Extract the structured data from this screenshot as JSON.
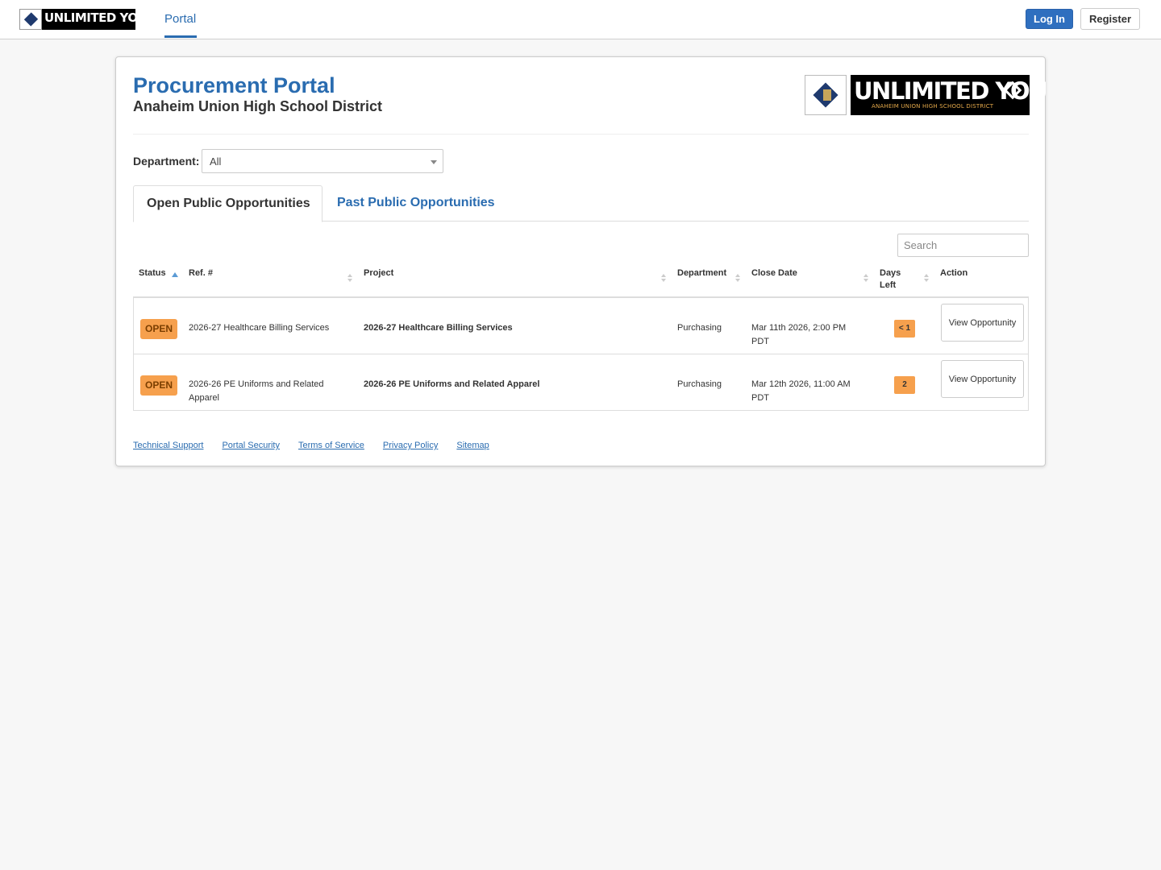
{
  "topnav": {
    "logo_text": "UNLIMITED YOU",
    "tab_portal": "Portal",
    "login": "Log In",
    "register": "Register"
  },
  "header": {
    "title": "Procurement Portal",
    "subtitle": "Anaheim Union High School District",
    "logo_main": "UNLIMITED YOU",
    "logo_sub": "ANAHEIM UNION HIGH SCHOOL DISTRICT"
  },
  "filter": {
    "department_label": "Department:",
    "department_value": "All"
  },
  "tabs": {
    "open": "Open Public Opportunities",
    "past": "Past Public Opportunities"
  },
  "search": {
    "placeholder": "Search"
  },
  "table": {
    "columns": [
      "Status",
      "Ref. #",
      "Project",
      "Department",
      "Close Date",
      "Days Left",
      "Action"
    ],
    "rows": [
      {
        "status": "OPEN",
        "ref": "2026-27 Healthcare Billing Services",
        "project": "2026-27 Healthcare Billing Services",
        "department": "Purchasing",
        "close_date": "Mar 11th 2026, 2:00 PM PDT",
        "days_left": "< 1",
        "action": "View Opportunity"
      },
      {
        "status": "OPEN",
        "ref": "2026-26 PE Uniforms and Related Apparel",
        "project": "2026-26 PE Uniforms and Related Apparel",
        "department": "Purchasing",
        "close_date": "Mar 12th 2026, 11:00 AM PDT",
        "days_left": "2",
        "action": "View Opportunity"
      }
    ]
  },
  "footer": {
    "links": [
      "Technical Support",
      "Portal Security",
      "Terms of Service",
      "Privacy Policy",
      "Sitemap"
    ]
  },
  "colors": {
    "accent": "#2a6cb0",
    "badge": "#f6a04d",
    "background": "#f7f7f7"
  }
}
